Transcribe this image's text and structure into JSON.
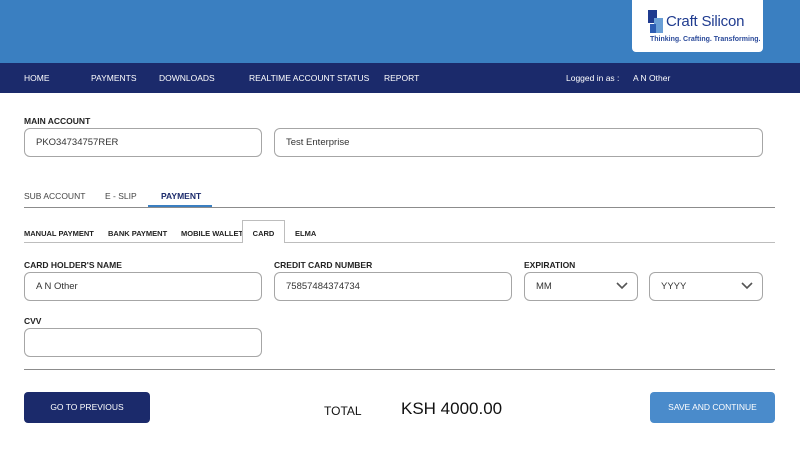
{
  "brand": {
    "name": "Craft Silicon",
    "tagline": "Thinking. Crafting. Transforming."
  },
  "nav": {
    "items": [
      "HOME",
      "PAYMENTS",
      "DOWNLOADS",
      "REALTIME ACCOUNT STATUS",
      "REPORT"
    ],
    "logged_in_label": "Logged in as :",
    "user": "A N Other"
  },
  "main_account": {
    "label": "MAIN ACCOUNT",
    "account_number": "PKO34734757RER",
    "account_name": "Test Enterprise"
  },
  "tabs": {
    "items": [
      "SUB ACCOUNT",
      "E - SLIP",
      "PAYMENT"
    ],
    "active": "PAYMENT"
  },
  "sub_tabs": {
    "items": [
      "MANUAL PAYMENT",
      "BANK PAYMENT",
      "MOBILE WALLET",
      "CARD",
      "ELMA"
    ],
    "active": "CARD"
  },
  "card_form": {
    "holder_label": "CARD HOLDER'S NAME",
    "holder_value": "A N Other",
    "number_label": "CREDIT CARD NUMBER",
    "number_value": "75857484374734",
    "expiration_label": "EXPIRATION",
    "month_value": "MM",
    "year_value": "YYYY",
    "cvv_label": "CVV",
    "cvv_value": ""
  },
  "footer": {
    "prev_label": "GO TO PREVIOUS",
    "total_label": "TOTAL",
    "total_amount": "KSH 4000.00",
    "continue_label": "SAVE AND CONTINUE"
  },
  "colors": {
    "header_blue": "#3a7fc1",
    "nav_navy": "#1b2a6b",
    "prev_button": "#1b2a6b",
    "continue_button": "#4a8bcb"
  }
}
